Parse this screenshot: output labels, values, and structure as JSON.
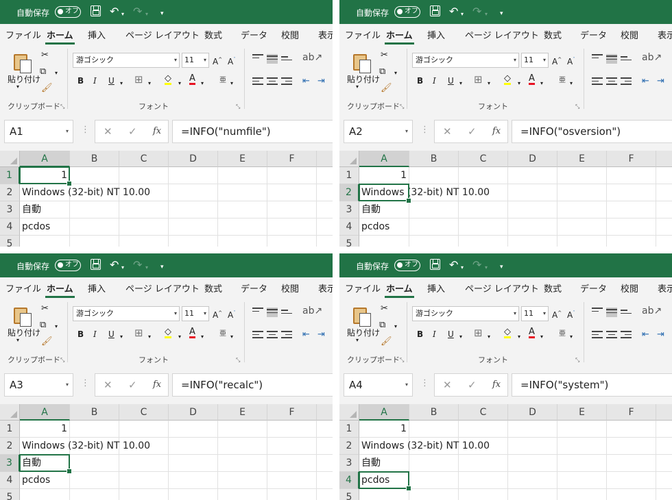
{
  "titlebar": {
    "autosave": "自動保存",
    "toggle": "オフ"
  },
  "tabs": [
    "ファイル",
    "ホーム",
    "挿入",
    "ページ レイアウト",
    "数式",
    "データ",
    "校閲",
    "表示"
  ],
  "ribbon": {
    "paste": "貼り付け",
    "clipboard_group": "クリップボード",
    "font_group": "フォント",
    "font_name": "游ゴシック",
    "font_size": "11",
    "grow_font": "A",
    "shrink_font": "A",
    "bold": "B",
    "italic": "I",
    "underline": "U",
    "phonetic": "亜"
  },
  "columns": [
    "A",
    "B",
    "C",
    "D",
    "E",
    "F"
  ],
  "rows": [
    "1",
    "2",
    "3",
    "4",
    "5"
  ],
  "cells": {
    "a1": "1",
    "a2": "Windows (32-bit) NT 10.00",
    "a3": "自動",
    "a4": "pcdos"
  },
  "panels": [
    {
      "namebox": "A1",
      "formula": "=INFO(\"numfile\")",
      "selected_row": 1
    },
    {
      "namebox": "A2",
      "formula": "=INFO(\"osversion\")",
      "selected_row": 2
    },
    {
      "namebox": "A3",
      "formula": "=INFO(\"recalc\")",
      "selected_row": 3
    },
    {
      "namebox": "A4",
      "formula": "=INFO(\"system\")",
      "selected_row": 4
    }
  ],
  "colors": {
    "excel_green": "#217346",
    "highlight_yellow": "#ffff00",
    "font_red": "#e81123"
  },
  "icons": [
    "save-icon",
    "undo-icon",
    "redo-icon",
    "paste-icon",
    "cut-icon",
    "copy-icon",
    "format-painter-icon",
    "cancel-icon",
    "enter-icon",
    "function-icon"
  ]
}
